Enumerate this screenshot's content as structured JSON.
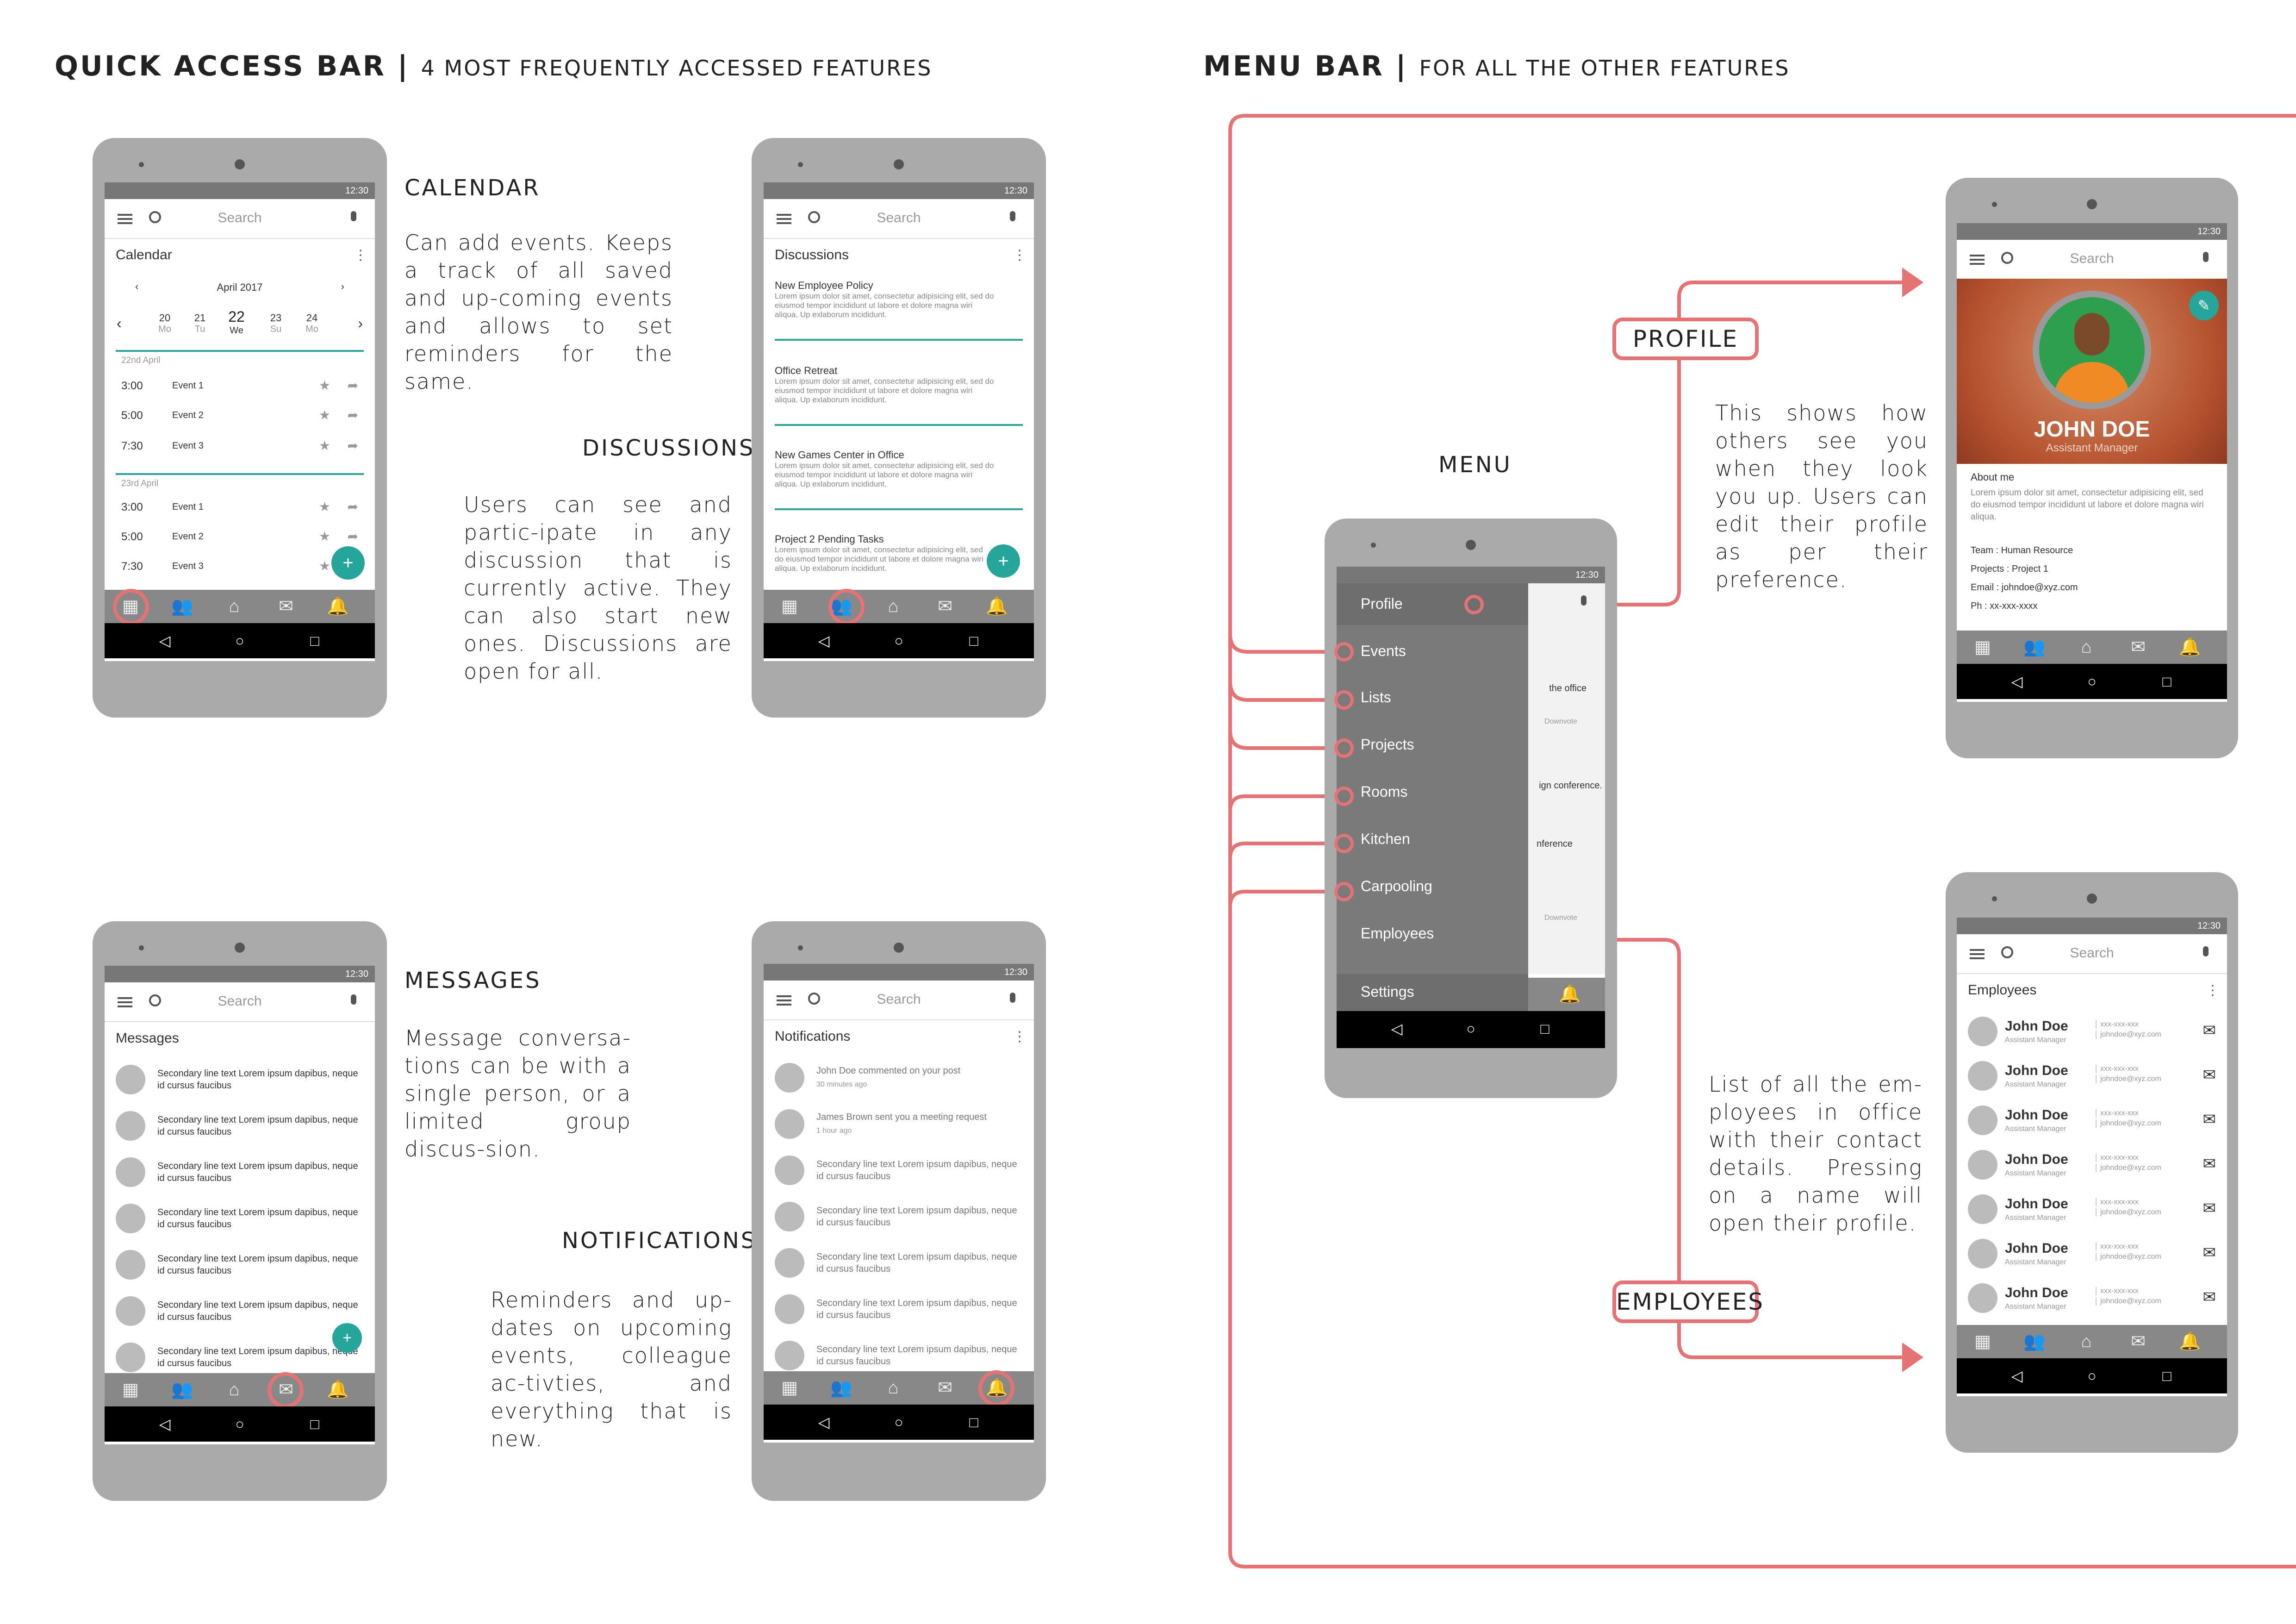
{
  "left": {
    "title": "QUICK ACCESS BAR",
    "subtitle": "4 MOST FREQUENTLY ACCESSED FEATURES",
    "features": {
      "calendar": {
        "title": "CALENDAR",
        "desc": "Can add events. Keeps a track of all saved and up-coming events and allows to set reminders for the same."
      },
      "discussions": {
        "title": "DISCUSSIONS",
        "desc": "Users can see and partic-ipate in any discussion that is currently active. They can also start new ones. Discussions are open for all."
      },
      "messages": {
        "title": "MESSAGES",
        "desc": "Message conversa-tions can be with a single person, or a limited group discus-sion."
      },
      "notifications": {
        "title": "NOTIFICATIONS",
        "desc": "Reminders and up-dates on upcoming events, colleague ac-tivties, and everything that is new."
      }
    }
  },
  "right": {
    "title": "MENU BAR",
    "subtitle": "FOR ALL THE OTHER FEATURES",
    "menu_label": "MENU",
    "profile_label": "PROFILE",
    "employees_label": "EMPLOYEES",
    "profile_desc": "This shows how others see you when they look you up. Users can edit their profile as per their preference.",
    "employees_desc": "List of all the em-ployees in office with their contact details. Pressing on a name will open their profile."
  },
  "phone": {
    "time": "12:30",
    "search_placeholder": "Search",
    "lorem": "Lorem ipsum dolor sit amet, consectetur adipisicing elit, sed do eiusmod tempor incididunt ut labore et dolore magna wiri aliqua. Up exlaborum incididunt.",
    "secondary": "Secondary line text Lorem ipsum dapibus, neque id cursus faucibus"
  },
  "calendar_screen": {
    "header": "Calendar",
    "month": "April 2017",
    "days": [
      {
        "num": "20",
        "day": "Mo"
      },
      {
        "num": "21",
        "day": "Tu"
      },
      {
        "num": "22",
        "day": "We"
      },
      {
        "num": "23",
        "day": "Su"
      },
      {
        "num": "24",
        "day": "Mo"
      }
    ],
    "date1": "22nd April",
    "date2": "23rd April",
    "events1": [
      {
        "time": "3:00",
        "name": "Event 1"
      },
      {
        "time": "5:00",
        "name": "Event 2"
      },
      {
        "time": "7:30",
        "name": "Event 3"
      }
    ],
    "events2": [
      {
        "time": "3:00",
        "name": "Event 1"
      },
      {
        "time": "5:00",
        "name": "Event 2"
      },
      {
        "time": "7:30",
        "name": "Event 3"
      }
    ]
  },
  "discussions_screen": {
    "header": "Discussions",
    "items": [
      "New Employee Policy",
      "Office Retreat",
      "New Games Center in Office",
      "Project 2 Pending Tasks"
    ]
  },
  "messages_screen": {
    "header": "Messages"
  },
  "notifications_screen": {
    "header": "Notifications",
    "items": [
      {
        "text": "John Doe commented on your post",
        "time": "30 minutes ago"
      },
      {
        "text": "James Brown sent you a meeting request",
        "time": "1 hour ago"
      }
    ]
  },
  "menu_screen": {
    "items": [
      "Profile",
      "Events",
      "Lists",
      "Projects",
      "Rooms",
      "Kitchen",
      "Carpooling",
      "Employees",
      "Settings"
    ],
    "bg_snippets": [
      "the office",
      "Downvote",
      "ign conference.",
      "nference",
      "Downvote"
    ]
  },
  "profile_screen": {
    "name": "JOHN DOE",
    "role": "Assistant Manager",
    "about_title": "About me",
    "about": "Lorem ipsum dolor sit amet, consectetur adipisicing elit, sed do eiusmod tempor incididunt ut labore et dolore magna wiri aliqua.",
    "team": "Team : Human Resource",
    "projects": "Projects : Project 1",
    "email": "Email : johndoe@xyz.com",
    "phone": "Ph : xx-xxx-xxxx"
  },
  "employees_screen": {
    "header": "Employees",
    "name": "John Doe",
    "role": "Assistant Manager",
    "phone": "xxx-xxx-xxx",
    "email": "johndoe@xyz.com"
  },
  "colors": {
    "accent": "#26a69a",
    "highlight": "#e57373",
    "phone_body": "#aaaaaa"
  }
}
